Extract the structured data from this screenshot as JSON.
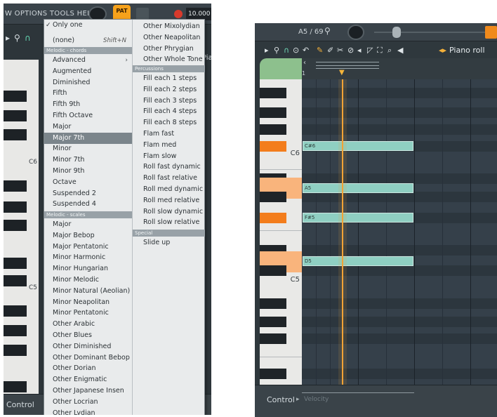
{
  "left_panel": {
    "menu_text": "W OPTIONS TOOLS HELP",
    "pat_label": "PAT",
    "tempo_value": "10.000",
    "key_labels": [
      "C6",
      "C5"
    ],
    "control_label": "Control",
    "partial_label": "Pia"
  },
  "dropdown": {
    "column1": {
      "only_one": "Only one",
      "none": "(none)",
      "none_shortcut": "Shift+N",
      "section_chords": "Melodic - chords",
      "chords": [
        "Advanced",
        "Augmented",
        "Diminished",
        "Fifth",
        "Fifth 9th",
        "Fifth Octave",
        "Major",
        "Major 7th",
        "Minor",
        "Minor 7th",
        "Minor 9th",
        "Octave",
        "Suspended 2",
        "Suspended 4"
      ],
      "selected": "Major 7th",
      "section_scales": "Melodic - scales",
      "scales": [
        "Major",
        "Major Bebop",
        "Major Pentatonic",
        "Minor Harmonic",
        "Minor Hungarian",
        "Minor Melodic",
        "Minor Natural (Aeolian)",
        "Minor Neapolitan",
        "Minor Pentatonic",
        "Other Arabic",
        "Other Blues",
        "Other Diminished",
        "Other Dominant Bebop",
        "Other Dorian",
        "Other Enigmatic",
        "Other Japanese Insen",
        "Other Locrian",
        "Other Lydian"
      ]
    },
    "column2": {
      "scales": [
        "Other Mixolydian",
        "Other Neapolitan",
        "Other Phrygian",
        "Other Whole Tone"
      ],
      "section_percussions": "Percussions",
      "percussions": [
        "Fill each 1 steps",
        "Fill each 2 steps",
        "Fill each 3 steps",
        "Fill each 4 steps",
        "Fill each 8 steps",
        "Flam fast",
        "Flam med",
        "Flam slow",
        "Roll fast dynamic",
        "Roll fast relative",
        "Roll med dynamic",
        "Roll med relative",
        "Roll slow dynamic",
        "Roll slow relative"
      ],
      "section_special": "Special",
      "special": [
        "Slide up"
      ]
    }
  },
  "right_panel": {
    "note_info": "A5 / 69",
    "title": "Piano roll",
    "ruler_bar": "1",
    "key_labels": [
      "C6",
      "C5"
    ],
    "notes": [
      "C#6",
      "A5",
      "F#5",
      "D5"
    ],
    "control_label": "Control",
    "velocity_label": "Velocity"
  },
  "colors": {
    "note_fill": "#8fcfc2",
    "playhead": "#f2a336",
    "selected_menu": "#7b858b",
    "pat_orange": "#f7a21b"
  }
}
